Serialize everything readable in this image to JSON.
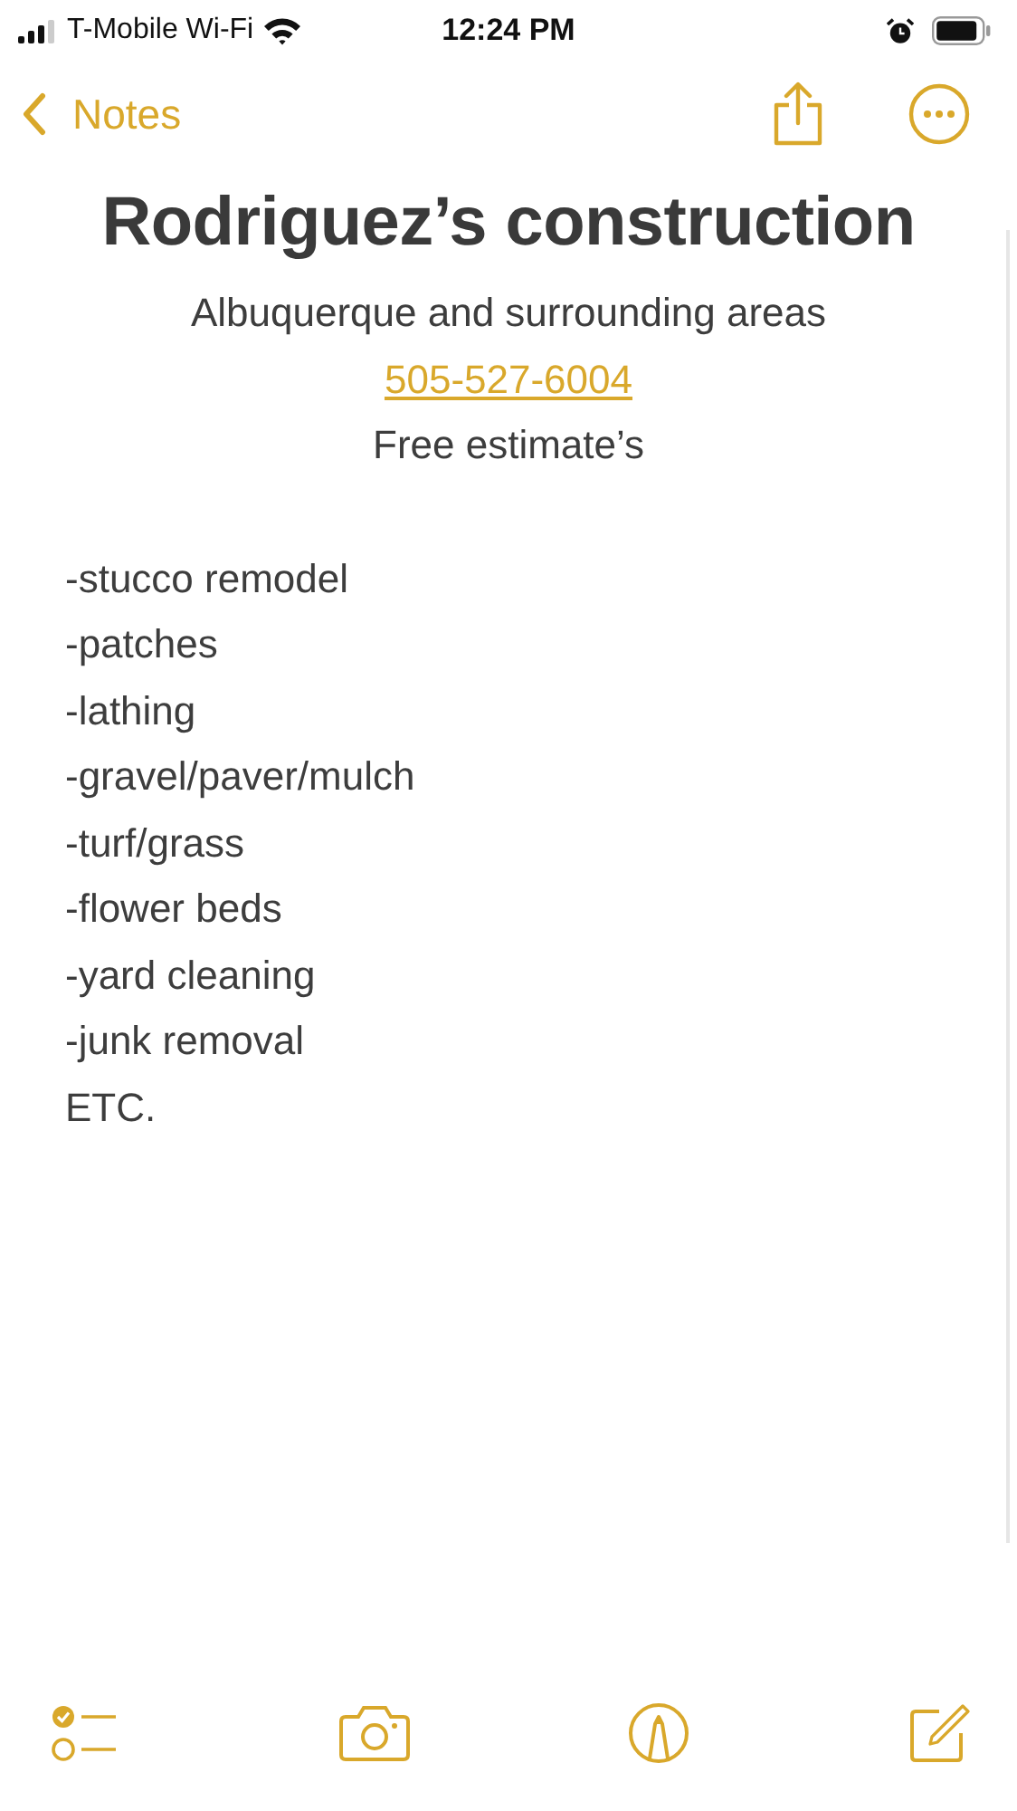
{
  "status_bar": {
    "carrier": "T-Mobile Wi-Fi",
    "time": "12:24 PM"
  },
  "nav": {
    "back_label": "Notes"
  },
  "note": {
    "title": "Rodriguez’s construction",
    "centered_lines": [
      {
        "text": "Albuquerque and surrounding areas",
        "kind": "text"
      },
      {
        "text": "505-527-6004",
        "kind": "link"
      },
      {
        "text": "Free estimate’s",
        "kind": "text"
      }
    ],
    "lines": [
      "-stucco remodel",
      "-patches",
      "-lathing",
      "-gravel/paver/mulch",
      "-turf/grass",
      "-flower beds",
      "-yard cleaning",
      "-junk removal",
      "ETC."
    ]
  }
}
